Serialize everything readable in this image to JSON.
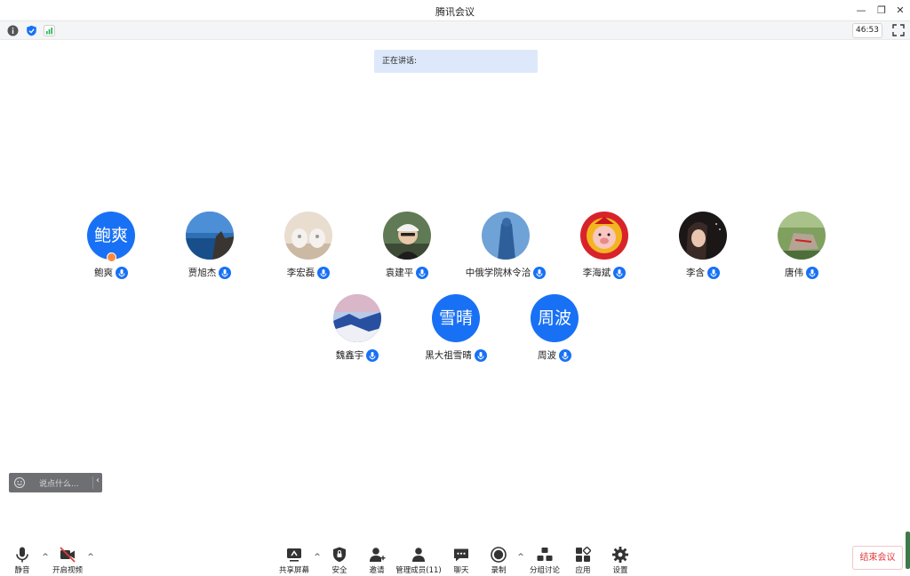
{
  "window": {
    "title": "腾讯会议",
    "minimize_glyph": "—",
    "restore_glyph": "❐",
    "close_glyph": "✕"
  },
  "infobar": {
    "timer": "46:53",
    "icons": [
      "info-icon",
      "shield-icon",
      "signal-icon"
    ]
  },
  "speaking": {
    "label": "正在讲话:"
  },
  "participants": [
    {
      "name": "鲍爽",
      "avatar_text": "鲍爽",
      "host": true
    },
    {
      "name": "贾旭杰",
      "avatar_text": ""
    },
    {
      "name": "李宏磊",
      "avatar_text": ""
    },
    {
      "name": "袁建平",
      "avatar_text": ""
    },
    {
      "name": "中俄学院林令洽",
      "avatar_text": ""
    },
    {
      "name": "李海斌",
      "avatar_text": ""
    },
    {
      "name": "李含",
      "avatar_text": ""
    },
    {
      "name": "唐伟",
      "avatar_text": ""
    },
    {
      "name": "魏鑫宇",
      "avatar_text": ""
    },
    {
      "name": "黑大祖雪晴",
      "avatar_text": "雪晴"
    },
    {
      "name": "周波",
      "avatar_text": "周波"
    }
  ],
  "chat": {
    "placeholder": "说点什么...",
    "collapse_glyph": "‹"
  },
  "toolbar": {
    "mute": "静音",
    "video": "开启视频",
    "share": "共享屏幕",
    "security": "安全",
    "invite": "邀请",
    "members": "管理成员(11)",
    "chat": "聊天",
    "record": "录制",
    "breakout": "分组讨论",
    "apps": "应用",
    "settings": "设置",
    "caret": "^",
    "end": "结束会议"
  },
  "colors": {
    "accent": "#1871f5",
    "end_red": "#e23b3b",
    "speaking_bg": "#dde9fb"
  }
}
